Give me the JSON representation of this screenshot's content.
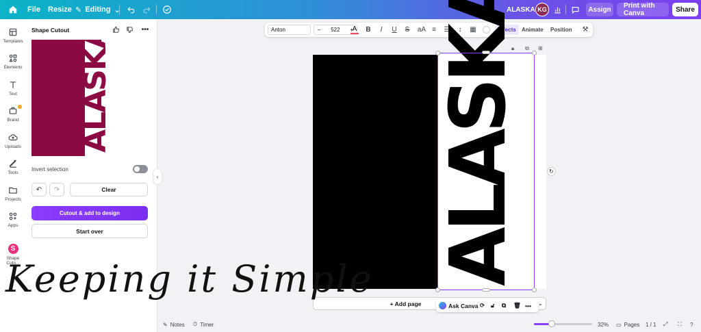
{
  "topbar": {
    "home_icon": "home-icon",
    "file": "File",
    "resize": "Resize",
    "editing": "Editing",
    "title": "ALASKA",
    "avatar": "KG",
    "assign": "Assign",
    "print": "Print with Canva",
    "share": "Share"
  },
  "rail": [
    {
      "label": "Templates",
      "icon": "templates-icon"
    },
    {
      "label": "Elements",
      "icon": "elements-icon"
    },
    {
      "label": "Text",
      "icon": "text-icon"
    },
    {
      "label": "Brand",
      "icon": "brand-icon"
    },
    {
      "label": "Uploads",
      "icon": "uploads-icon"
    },
    {
      "label": "Tools",
      "icon": "tools-icon"
    },
    {
      "label": "Projects",
      "icon": "projects-icon"
    },
    {
      "label": "Apps",
      "icon": "apps-icon"
    },
    {
      "label": "Shape Cuto...",
      "icon": "shape-cutout-app-icon"
    }
  ],
  "panel": {
    "title": "Shape Cutout",
    "preview_text": "ALASKA",
    "invert_label": "Invert selection",
    "invert_on": false,
    "clear": "Clear",
    "cutout": "Cutout & add to design",
    "start_over": "Start over",
    "preview_color": "#8c0a44"
  },
  "text_toolbar": {
    "font": "Anton",
    "size": "522",
    "effects": "Effects",
    "animate": "Animate",
    "position": "Position"
  },
  "canvas": {
    "text": "ALASKA",
    "add_page": "+ Add page"
  },
  "ask": {
    "label": "Ask Canva"
  },
  "overlay_text": "Keeping it Simple",
  "footer": {
    "notes": "Notes",
    "timer": "Timer",
    "zoom": "32%",
    "zoom_fraction": 0.32,
    "pages": "Pages",
    "page_count": "1 / 1"
  },
  "colors": {
    "accent": "#8b3dff"
  }
}
